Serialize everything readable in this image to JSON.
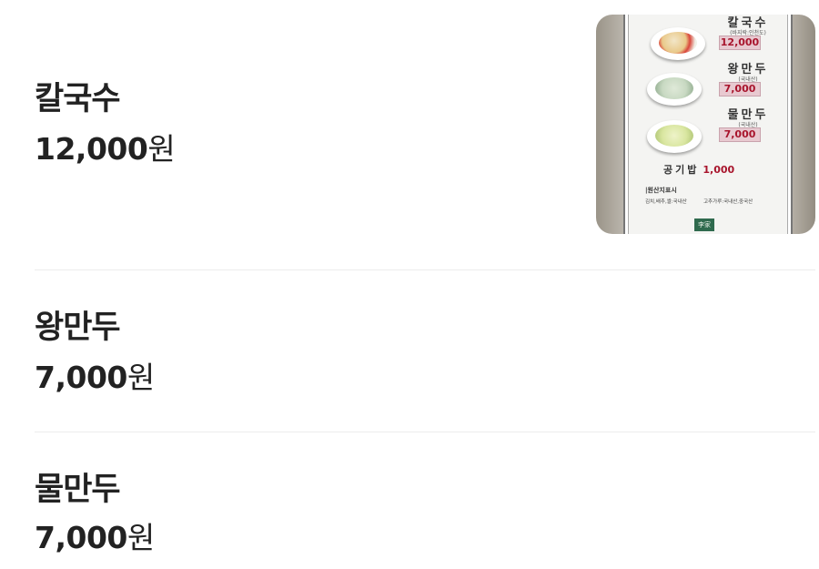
{
  "menu_items": [
    {
      "name": "칼국수",
      "price": "12,000",
      "currency": "원"
    },
    {
      "name": "왕만두",
      "price": "7,000",
      "currency": "원"
    },
    {
      "name": "물만두",
      "price": "7,000",
      "currency": "원"
    }
  ],
  "photo": {
    "board_items": [
      {
        "name": "칼국수",
        "note": "(바지락:인천도)",
        "price": "12,000"
      },
      {
        "name": "왕만두",
        "note": "(국내산)",
        "price": "7,000"
      },
      {
        "name": "물만두",
        "note": "(국내산)",
        "price": "7,000"
      }
    ],
    "rice": {
      "name": "공기밥",
      "price": "1,000"
    },
    "origin_title": "|원산지표시",
    "origin_line_1": "김치,배추,쌀:국내산",
    "origin_line_2": "고추가루:국내산,중국산",
    "logo_text": "李家",
    "price_color": "#a8142c"
  }
}
